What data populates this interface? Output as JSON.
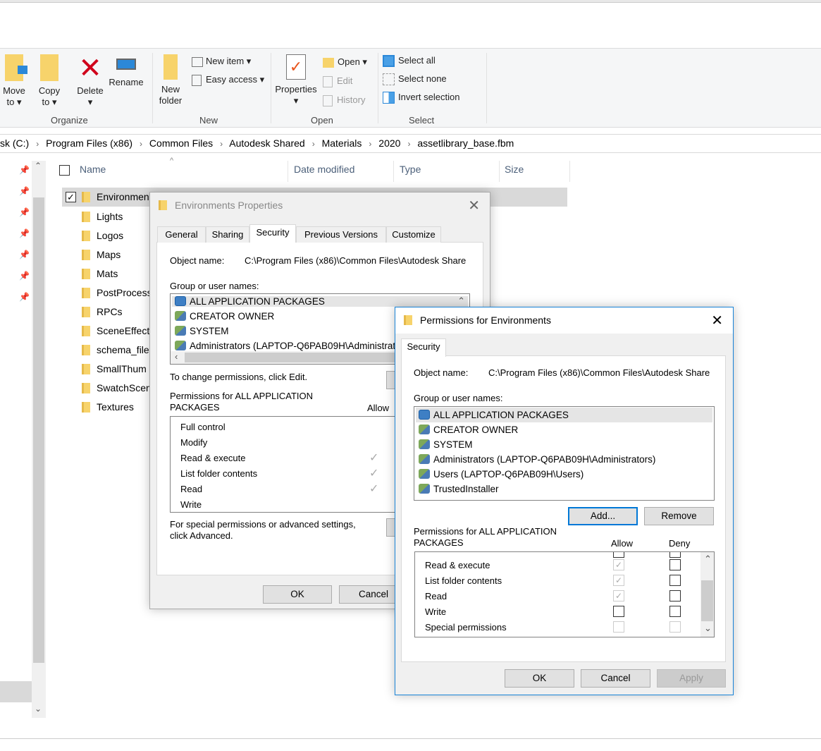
{
  "ribbon": {
    "organize": {
      "label": "Organize",
      "move_to": "Move to",
      "copy_to": "Copy to",
      "delete": "Delete",
      "rename": "Rename"
    },
    "new": {
      "label": "New",
      "new_folder": "New folder",
      "new_item": "New item",
      "easy_access": "Easy access"
    },
    "open": {
      "label": "Open",
      "properties": "Properties",
      "open": "Open",
      "edit": "Edit",
      "history": "History"
    },
    "select": {
      "label": "Select",
      "select_all": "Select all",
      "select_none": "Select none",
      "invert": "Invert selection"
    }
  },
  "breadcrumb": [
    "sk (C:)",
    "Program Files (x86)",
    "Common Files",
    "Autodesk Shared",
    "Materials",
    "2020",
    "assetlibrary_base.fbm"
  ],
  "columns": {
    "name": "Name",
    "date": "Date modified",
    "type": "Type",
    "size": "Size"
  },
  "files": [
    "Environments",
    "Lights",
    "Logos",
    "Maps",
    "Mats",
    "PostProcess",
    "RPCs",
    "SceneEffect",
    "schema_file",
    "SmallThum",
    "SwatchScen",
    "Textures"
  ],
  "props": {
    "title": "Environments Properties",
    "tabs": [
      "General",
      "Sharing",
      "Security",
      "Previous Versions",
      "Customize"
    ],
    "object_label": "Object name:",
    "object_value": "C:\\Program Files (x86)\\Common Files\\Autodesk Share",
    "group_label": "Group or user names:",
    "groups": [
      "ALL APPLICATION PACKAGES",
      "CREATOR OWNER",
      "SYSTEM",
      "Administrators (LAPTOP-Q6PAB09H\\Administrato"
    ],
    "change_text": "To change permissions, click Edit.",
    "perm_for": "Permissions for ALL APPLICATION PACKAGES",
    "allow": "Allow",
    "perms": [
      "Full control",
      "Modify",
      "Read & execute",
      "List folder contents",
      "Read",
      "Write"
    ],
    "allowed": [
      false,
      false,
      true,
      true,
      true,
      false
    ],
    "special_text": "For special permissions or advanced settings, click Advanced.",
    "ok": "OK",
    "cancel": "Cancel"
  },
  "perm_dlg": {
    "title": "Permissions for Environments",
    "tab": "Security",
    "object_label": "Object name:",
    "object_value": "C:\\Program Files (x86)\\Common Files\\Autodesk Share",
    "group_label": "Group or user names:",
    "groups": [
      "ALL APPLICATION PACKAGES",
      "CREATOR OWNER",
      "SYSTEM",
      "Administrators (LAPTOP-Q6PAB09H\\Administrators)",
      "Users (LAPTOP-Q6PAB09H\\Users)",
      "TrustedInstaller"
    ],
    "add": "Add...",
    "remove": "Remove",
    "perm_for": "Permissions for ALL APPLICATION PACKAGES",
    "allow": "Allow",
    "deny": "Deny",
    "perms": [
      "Read & execute",
      "List folder contents",
      "Read",
      "Write",
      "Special permissions"
    ],
    "allowed": [
      true,
      true,
      true,
      false,
      false
    ],
    "ok": "OK",
    "cancel": "Cancel",
    "apply": "Apply"
  }
}
